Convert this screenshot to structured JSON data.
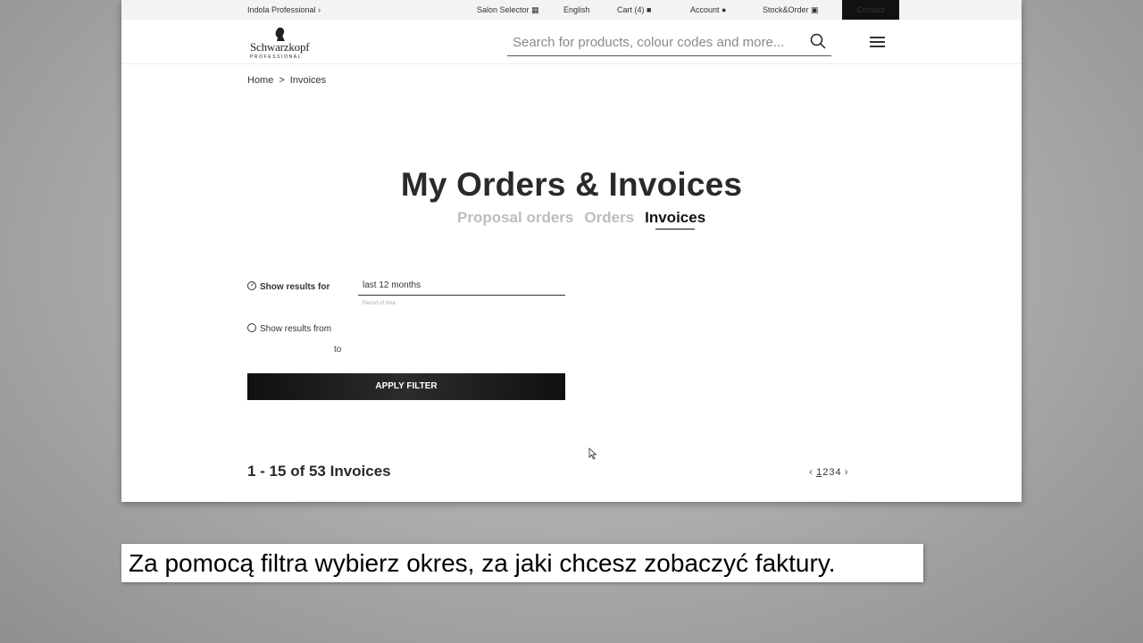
{
  "topbar": {
    "brand_link": "Indola Professional",
    "salon_selector": "Salon Selector",
    "language": "English",
    "cart": "Cart (4)",
    "account": "Account",
    "stock_order": "Stock&Order",
    "contact": "Contact"
  },
  "header": {
    "logo_text": "Schwarzkopf",
    "logo_sub": "PROFESSIONAL",
    "search_placeholder": "Search for products, colour codes and more..."
  },
  "breadcrumb": {
    "home": "Home",
    "sep": ">",
    "current": "Invoices"
  },
  "page": {
    "title": "My Orders & Invoices",
    "tabs": [
      {
        "label": "Proposal orders",
        "active": false
      },
      {
        "label": "Orders",
        "active": false
      },
      {
        "label": "Invoices",
        "active": true
      }
    ]
  },
  "filter": {
    "option1_label": "Show results for",
    "period_value": "last 12 months",
    "period_hint": "Period of time",
    "option2_label": "Show results from",
    "to_label": "to",
    "apply_label": "APPLY FILTER"
  },
  "results": {
    "summary": "1 - 15 of 53 Invoices",
    "pages": [
      "1",
      "2",
      "3",
      "4"
    ],
    "current_page": "1"
  },
  "caption": "Za pomocą filtra wybierz okres, za jaki chcesz zobaczyć faktury."
}
